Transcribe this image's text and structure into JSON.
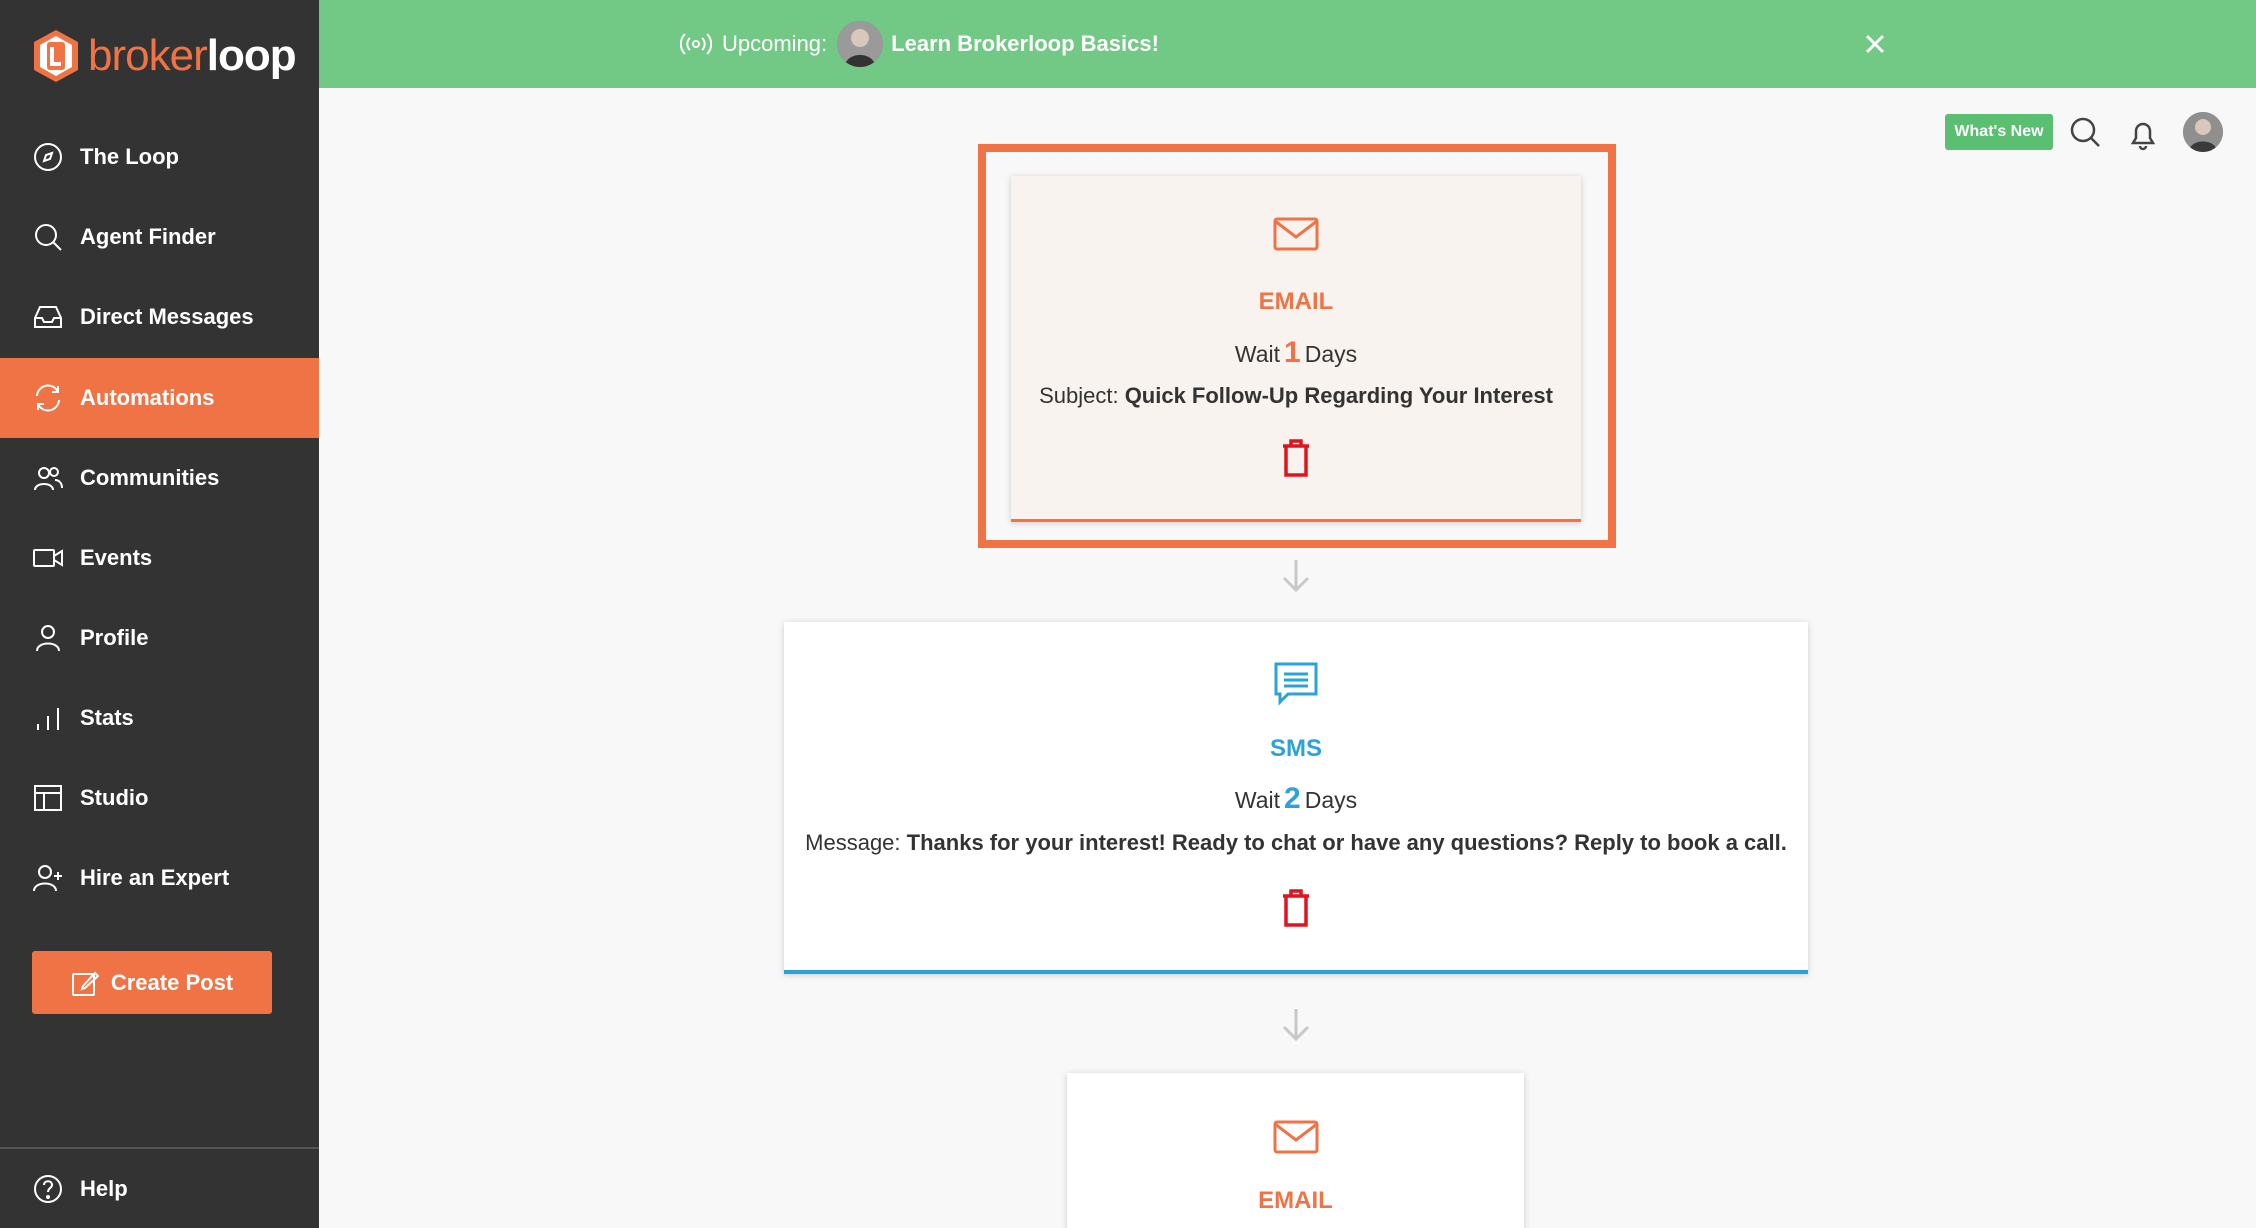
{
  "brand": {
    "part1": "broker",
    "part2": "loop",
    "accent": "#f07346"
  },
  "nav": [
    {
      "label": "The Loop",
      "icon": "compass-icon"
    },
    {
      "label": "Agent Finder",
      "icon": "search-icon"
    },
    {
      "label": "Direct Messages",
      "icon": "inbox-icon"
    },
    {
      "label": "Automations",
      "icon": "sync-icon",
      "active": true
    },
    {
      "label": "Communities",
      "icon": "users-icon"
    },
    {
      "label": "Events",
      "icon": "video-icon"
    },
    {
      "label": "Profile",
      "icon": "user-icon"
    },
    {
      "label": "Stats",
      "icon": "bar-chart-icon"
    },
    {
      "label": "Studio",
      "icon": "layout-icon"
    },
    {
      "label": "Hire an Expert",
      "icon": "user-plus-icon"
    }
  ],
  "create_post": {
    "label": "Create Post"
  },
  "help": {
    "label": "Help"
  },
  "banner": {
    "prefix": "Upcoming:",
    "title": "Learn Brokerloop Basics!",
    "color": "#72c985"
  },
  "toolbar": {
    "whats_new": "What's New"
  },
  "steps": [
    {
      "type": "EMAIL",
      "wait_prefix": "Wait",
      "wait_value": "1",
      "wait_suffix": "Days",
      "field_label": "Subject:",
      "field_value": "Quick Follow-Up Regarding Your Interest"
    },
    {
      "type": "SMS",
      "wait_prefix": "Wait",
      "wait_value": "2",
      "wait_suffix": "Days",
      "field_label": "Message:",
      "field_value": "Thanks for your interest! Ready to chat or have any questions? Reply to book a call."
    },
    {
      "type": "EMAIL"
    }
  ]
}
